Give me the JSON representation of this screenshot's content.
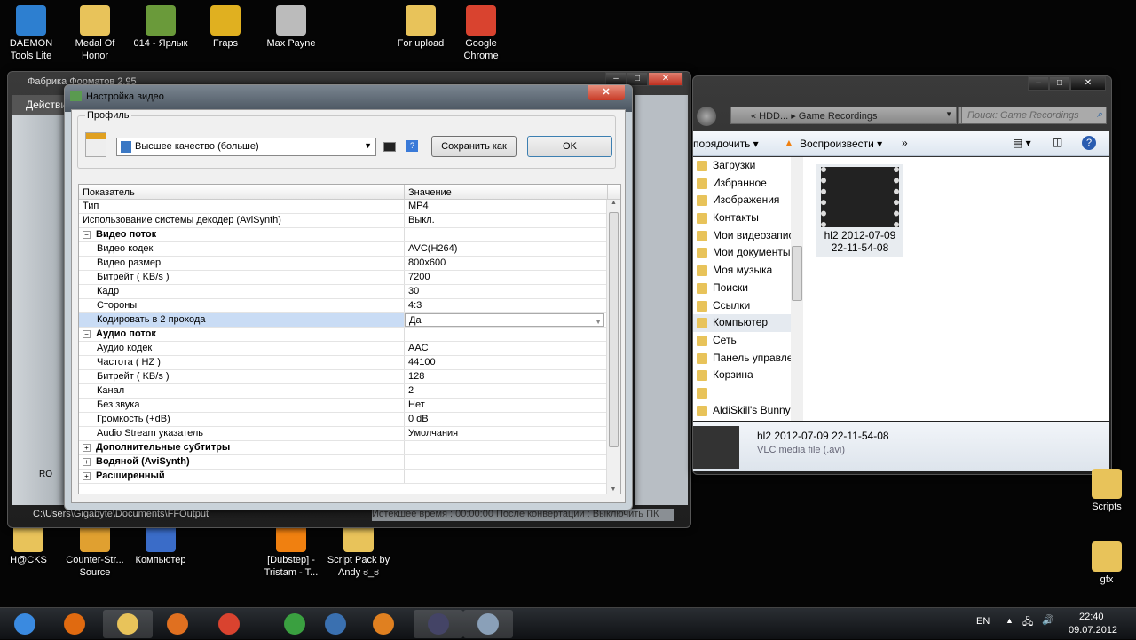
{
  "desktop": {
    "top_icons": [
      {
        "label": "DAEMON Tools Lite",
        "color": "#2d7fd0"
      },
      {
        "label": "Medal Of Honor",
        "color": "#e8c35a"
      },
      {
        "label": "014 - Ярлык",
        "color": "#6a9a3a"
      },
      {
        "label": "Fraps",
        "color": "#e0b020"
      },
      {
        "label": "Max Payne",
        "color": "#bbbbbb"
      },
      {
        "label": "For upload",
        "color": "#e8c35a"
      },
      {
        "label": "Google Chrome",
        "color": "#d9432f"
      }
    ],
    "bottom_icons": [
      {
        "label": "H@CKS",
        "color": "#e8c35a"
      },
      {
        "label": "Counter-Str... Source",
        "color": "#e0a030"
      },
      {
        "label": "Компьютер",
        "color": "#3a6cc8"
      },
      {
        "label": "[Dubstep] - Tristam - T...",
        "color": "#f08010"
      },
      {
        "label": "Script Pack by Andy ಠ_ಠ",
        "color": "#e8c35a"
      }
    ],
    "right_icons": [
      {
        "label": "Scripts",
        "color": "#e8c35a"
      },
      {
        "label": "gfx",
        "color": "#e8c35a"
      }
    ]
  },
  "bg_app": {
    "title": "Фабрика Форматов 2.95",
    "menu": "Действи",
    "side_item": "RO",
    "status_path": "C:\\Users\\Gigabyte\\Documents\\FFOutput",
    "status_right": "Истекшее время : 00:00:00    После конвертации : Выключить ПК"
  },
  "dialog": {
    "title": "Настройка видео",
    "profile_label": "Профиль",
    "profile_value": "Высшее качество (больше)",
    "save_as": "Сохранить как",
    "ok": "OK",
    "col_name": "Показатель",
    "col_value": "Значение",
    "rows": [
      {
        "name": "Тип",
        "value": "MP4"
      },
      {
        "name": "Использование системы декодер (AviSynth)",
        "value": "Выкл."
      },
      {
        "name": "Видео поток",
        "value": ""
      },
      {
        "name": "Видео кодек",
        "value": "AVC(H264)"
      },
      {
        "name": "Видео размер",
        "value": "800x600"
      },
      {
        "name": "Битрейт ( KB/s )",
        "value": "7200"
      },
      {
        "name": "Кадр",
        "value": "30"
      },
      {
        "name": "Стороны",
        "value": "4:3"
      },
      {
        "name": "Кодировать в 2 прохода",
        "value": "Да"
      },
      {
        "name": "Аудио поток",
        "value": ""
      },
      {
        "name": "Аудио кодек",
        "value": "AAC"
      },
      {
        "name": "Частота ( HZ )",
        "value": "44100"
      },
      {
        "name": "Битрейт ( KB/s )",
        "value": "128"
      },
      {
        "name": "Канал",
        "value": "2"
      },
      {
        "name": "Без звука",
        "value": "Нет"
      },
      {
        "name": "Громкость (+dB)",
        "value": "0 dB"
      },
      {
        "name": "Audio Stream указатель",
        "value": "Умолчания"
      },
      {
        "name": "Дополнительные субтитры",
        "value": ""
      },
      {
        "name": "Водяной (AviSynth)",
        "value": ""
      },
      {
        "name": "Расширенный",
        "value": ""
      }
    ]
  },
  "explorer": {
    "breadcrumb": "« HDD... ▸ Game Recordings",
    "search_placeholder": "Поиск: Game Recordings",
    "organize": "порядочить ▾",
    "play": "Воспроизвести ▾",
    "more": "»",
    "nav": [
      "Загрузки",
      "Избранное",
      "Изображения",
      "Контакты",
      "Мои видеозаписи",
      "Мои документы",
      "Моя музыка",
      "Поиски",
      "Ссылки",
      "Компьютер",
      "Сеть",
      "Панель управления",
      "Корзина",
      "",
      "AldiSkill's Bunnyhop"
    ],
    "file_name_line1": "hl2 2012-07-09",
    "file_name_line2": "22-11-54-08",
    "details_name": "hl2 2012-07-09 22-11-54-08",
    "details_type": "VLC media file (.avi)"
  },
  "taskbar": {
    "lang": "EN",
    "time": "22:40",
    "date": "09.07.2012",
    "apps": [
      {
        "name": "start",
        "color": "#3a8ae0"
      },
      {
        "name": "firefox",
        "color": "#e06a10"
      },
      {
        "name": "explorer",
        "color": "#e8c35a"
      },
      {
        "name": "media-player",
        "color": "#e07020"
      },
      {
        "name": "chrome",
        "color": "#d9432f"
      },
      {
        "name": "utorrent",
        "color": "#3aa040"
      },
      {
        "name": "settings",
        "color": "#3a70b0"
      },
      {
        "name": "blender",
        "color": "#e08020"
      },
      {
        "name": "game",
        "color": "#444466"
      },
      {
        "name": "format-factory",
        "color": "#8aa0b8"
      }
    ]
  }
}
